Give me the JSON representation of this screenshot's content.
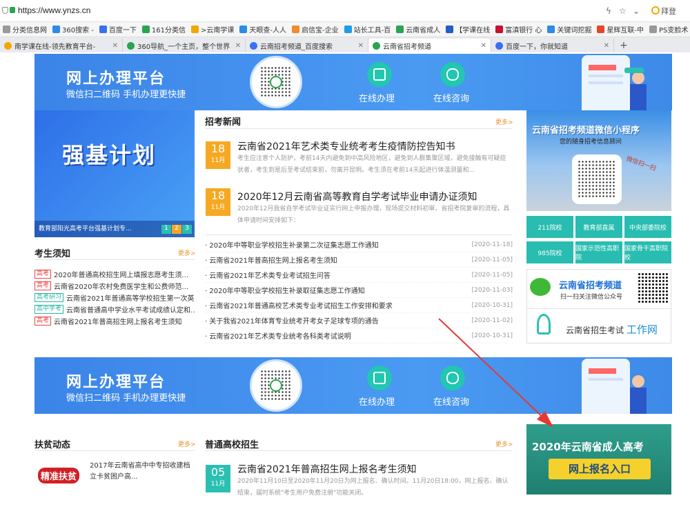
{
  "browser": {
    "url": "https://www.ynzs.cn",
    "user": "拜登",
    "bookmarks": [
      {
        "label": "分类信息网",
        "color": "#999"
      },
      {
        "label": "360搜索 -",
        "color": "#2e8be6"
      },
      {
        "label": "百度一下",
        "color": "#3a6ff5"
      },
      {
        "label": "161分类信",
        "color": "#2aa44f"
      },
      {
        "label": ">云南学课",
        "color": "#f0a800"
      },
      {
        "label": "天眼查-人人",
        "color": "#2e8be6"
      },
      {
        "label": "启信宝-企业",
        "color": "#f28b2c"
      },
      {
        "label": "站长工具-百",
        "color": "#1f9be8"
      },
      {
        "label": "云南省成人",
        "color": "#2aa44f"
      },
      {
        "label": "【学课在线",
        "color": "#1e5fc7"
      },
      {
        "label": "富滇银行 心",
        "color": "#c8102e"
      },
      {
        "label": "关键词挖掘",
        "color": "#2e8be6"
      },
      {
        "label": "星辉互联-中",
        "color": "#e8452c"
      },
      {
        "label": "PS变脸术",
        "color": "#999"
      }
    ],
    "tabs": [
      {
        "label": "南学课在线-领先教育平台-",
        "color": "#f0a800",
        "active": false
      },
      {
        "label": "360导航_一个主页，整个世界",
        "color": "#2aa44f",
        "active": false
      },
      {
        "label": "云南招考频道_百度搜索",
        "color": "#3a6ff5",
        "active": false
      },
      {
        "label": "云南省招考频道",
        "color": "#2aa44f",
        "active": true
      },
      {
        "label": "百度一下，你就知道",
        "color": "#3a6ff5",
        "active": false
      }
    ]
  },
  "banner": {
    "title": "网上办理平台",
    "subtitle": "微信扫二维码  手机办理更快捷",
    "btn1": "在线办理",
    "btn2": "在线咨询"
  },
  "left": {
    "promo_title": "强基计划",
    "promo_caption": "教育部阳光高考平台强基计划专...",
    "pager": [
      "1",
      "2",
      "3"
    ],
    "notice_title": "考生须知",
    "more": "更多>",
    "notices": [
      {
        "tag": "高考",
        "text": "2020年普通高校招生网上填报志愿考生须...",
        "green": false
      },
      {
        "tag": "高考",
        "text": "云南省2020年农村免费医学生和公费师范...",
        "green": false
      },
      {
        "tag": "高考研习",
        "text": "云南省2021年普通高等学校招生第一次英...",
        "green": true
      },
      {
        "tag": "高中学考",
        "text": "云南省普通高中学业水平考试成绩认定和...",
        "green": true
      },
      {
        "tag": "高考",
        "text": "云南省2021年普高招生网上报名考生须知",
        "green": false
      }
    ],
    "poverty_title": "扶贫动态",
    "poverty_item": "2017年云南省高中中专招收建档立卡贫困户高...",
    "poverty_img": "精准扶贫"
  },
  "news": {
    "title": "招考新闻",
    "more": "更多>",
    "featured": [
      {
        "day": "18",
        "month": "11月",
        "title": "云南省2021年艺术类专业统考考生疫情防控告知书",
        "desc": "考生应注意个人防护，考前14天内避免到中高风险地区，避免到人群集聚区域，避免接触有可疑症状者，考生到是后至考试结束前，勿离开昆明。考生须在考前14天起进行体温测量和..."
      },
      {
        "day": "18",
        "month": "11月",
        "title": "2020年12月云南省高等教育自学考试毕业申请办证须知",
        "desc": "2020年12月我省自学考试毕业证实行网上申报办理，现场提交材料初审、省招考院复审的流程，具体申请时间安排如下："
      }
    ],
    "list": [
      {
        "text": "2020年中等职业学校招生补录第二次征集志愿工作通知",
        "date": "[2020-11-18]"
      },
      {
        "text": "云南省2021年普高招生网上报名考生须知",
        "date": "[2020-11-05]"
      },
      {
        "text": "云南省2021年艺术类专业考试招生问答",
        "date": "[2020-11-05]"
      },
      {
        "text": "2020年中等职业学校招生补录取征集志愿工作通知",
        "date": "[2020-11-03]"
      },
      {
        "text": "云南省2021年普通高校艺术类专业考试招生工作安排和要求",
        "date": "[2020-10-31]"
      },
      {
        "text": "关于我省2021年体育专业统考开考女子足球专项的通告",
        "date": "[2020-11-02]"
      },
      {
        "text": "云南省2021年艺术类专业统考各科类考试说明",
        "date": "[2020-10-31]"
      }
    ]
  },
  "general": {
    "title": "普通高校招生",
    "more": "更多>",
    "day": "05",
    "month": "11月",
    "item_title": "云南省2021年普高招生网上报名考生须知",
    "item_desc": "2020年11月10日至2020年11月20日为网上报名、确认时间。11月20日18:00，网上报名、确认结束，届时系统\"考生用户免费注册\"功能关闭。"
  },
  "right": {
    "mini_title": "云南省招考频道微信小程序",
    "mini_sub": "您的随身招考信息顾问",
    "mini_scan": "微信扫一扫",
    "links": [
      "211院校",
      "教育部直属",
      "中央部委院校",
      "985院校",
      "国家示范性高职院",
      "国家骨干高职院校"
    ],
    "wechat_title": "云南省招考频道",
    "wechat_sub": "扫一扫关注微信公众号",
    "exam_label": "云南省招生考试",
    "exam_net": "工作网",
    "adult_title": "2020年云南省成人高考",
    "adult_btn": "网上报名入口"
  },
  "colors": {
    "accent": "#e8932c",
    "teal": "#28bdb0",
    "banner": "#3b84e8"
  }
}
